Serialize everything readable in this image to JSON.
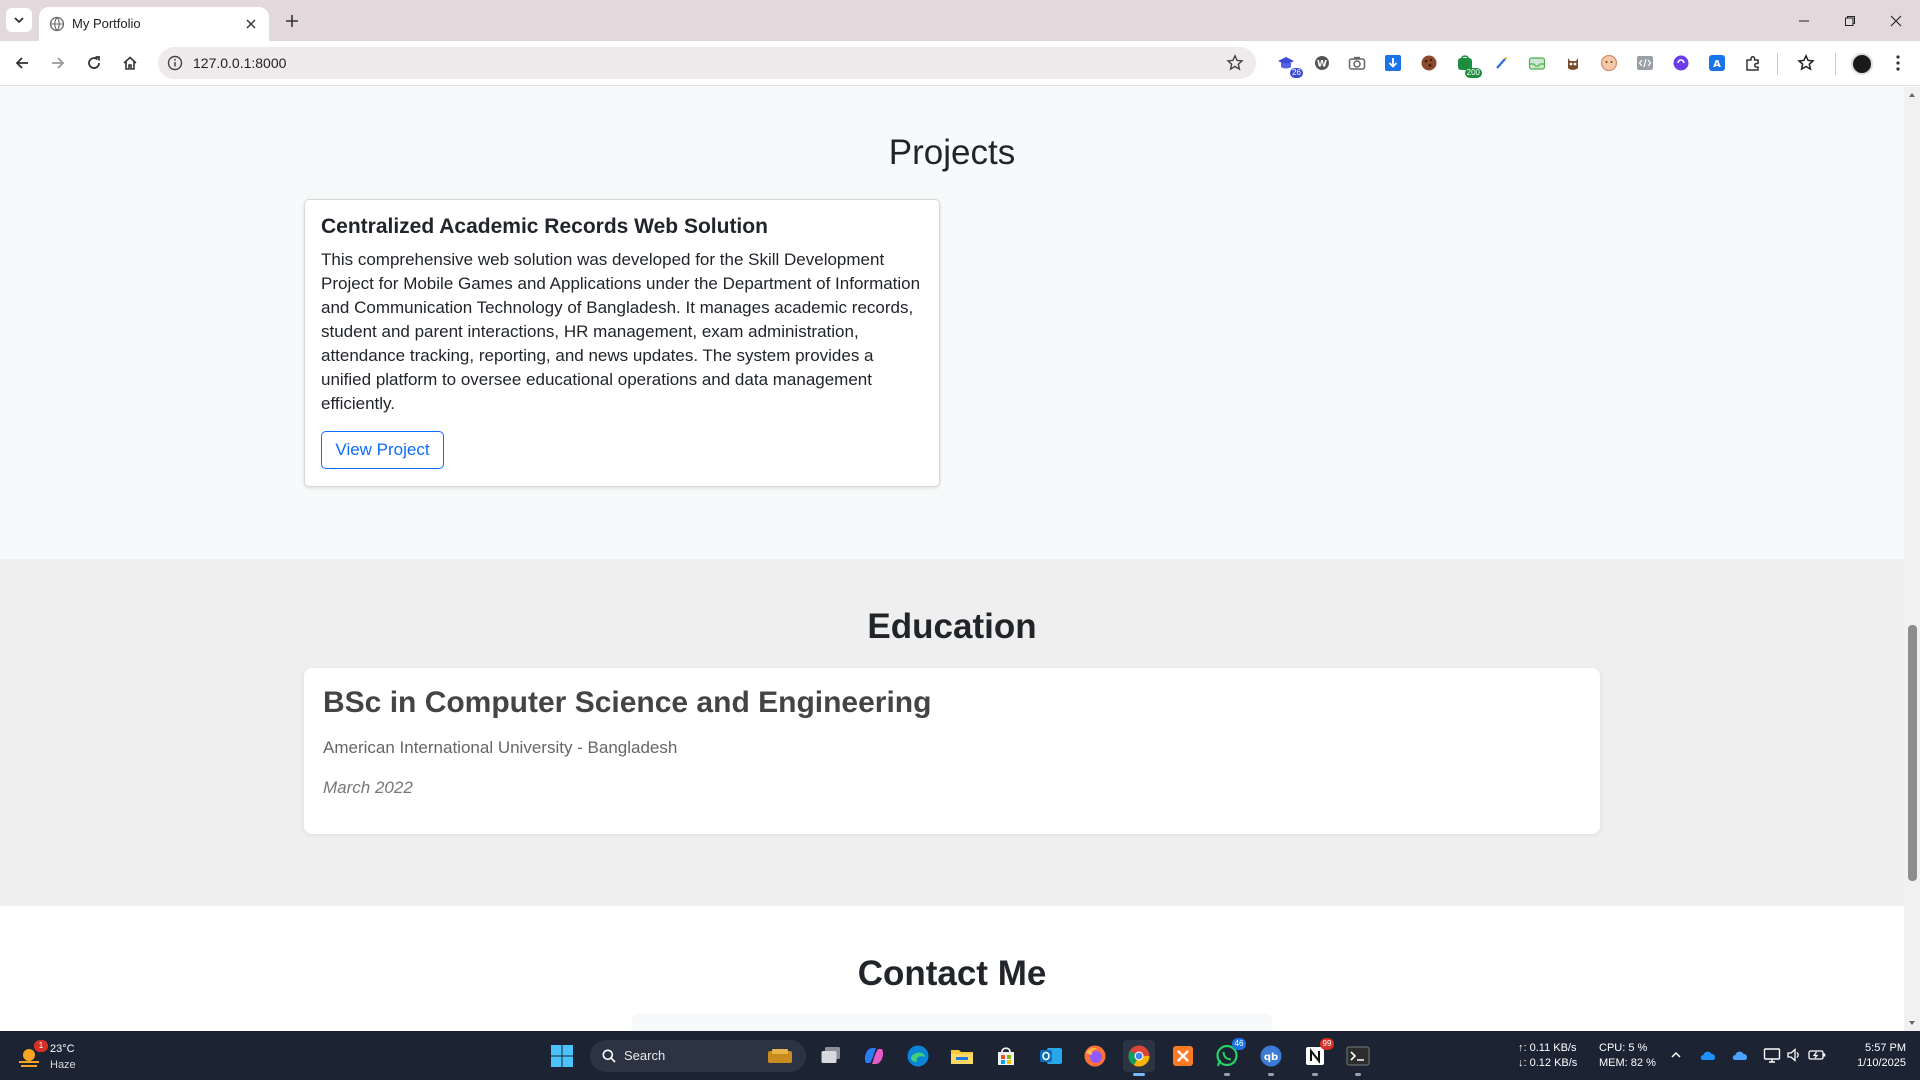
{
  "browser": {
    "tab_title": "My Portfolio",
    "url": "127.0.0.1:8000",
    "extensions": [
      {
        "name": "ext-hat-icon",
        "badge": "26",
        "badge_color": "#3b4bd6"
      },
      {
        "name": "ext-wordpress-icon"
      },
      {
        "name": "ext-camera-icon"
      },
      {
        "name": "ext-download-icon"
      },
      {
        "name": "ext-cookie-icon"
      },
      {
        "name": "ext-green-bag-icon",
        "badge": "200",
        "badge_color": "#1e8e3e"
      },
      {
        "name": "ext-pen-icon"
      },
      {
        "name": "ext-inbox-icon"
      },
      {
        "name": "ext-owl-icon"
      },
      {
        "name": "ext-face-icon"
      },
      {
        "name": "ext-code-icon"
      },
      {
        "name": "ext-circle-purple-icon"
      },
      {
        "name": "ext-translate-icon"
      },
      {
        "name": "extensions-puzzle-icon"
      },
      {
        "name": "bookmarks-star-icon"
      }
    ]
  },
  "page": {
    "projects": {
      "title": "Projects",
      "items": [
        {
          "name": "Centralized Academic Records Web Solution",
          "description": "This comprehensive web solution was developed for the Skill Development Project for Mobile Games and Applications under the Department of Information and Communication Technology of Bangladesh. It manages academic records, student and parent interactions, HR management, exam administration, attendance tracking, reporting, and news updates. The system provides a unified platform to oversee educational operations and data management efficiently.",
          "button_label": "View Project"
        }
      ]
    },
    "education": {
      "title": "Education",
      "degree": "BSc in Computer Science and Engineering",
      "school": "American International University - Bangladesh",
      "date": "March 2022"
    },
    "contact": {
      "title": "Contact Me"
    }
  },
  "taskbar": {
    "weather": {
      "temp": "23°C",
      "condition": "Haze",
      "badge": "1"
    },
    "search_label": "Search",
    "apps": [
      {
        "name": "start-icon"
      },
      {
        "name": "task-view-icon"
      },
      {
        "name": "copilot-icon"
      },
      {
        "name": "edge-icon"
      },
      {
        "name": "file-explorer-icon"
      },
      {
        "name": "store-icon"
      },
      {
        "name": "outlook-icon"
      },
      {
        "name": "firefox-icon"
      },
      {
        "name": "chrome-icon"
      },
      {
        "name": "xampp-icon"
      },
      {
        "name": "whatsapp-icon",
        "badge": "46"
      },
      {
        "name": "qbittorrent-icon"
      },
      {
        "name": "notion-icon",
        "badge": "99"
      },
      {
        "name": "terminal-icon"
      }
    ],
    "net": {
      "up": "↑: 0.11 KB/s",
      "down": "↓: 0.12 KB/s"
    },
    "sys": {
      "cpu": "CPU: 5 %",
      "mem": "MEM: 82 %"
    },
    "clock": {
      "time": "5:57 PM",
      "date": "1/10/2025"
    }
  }
}
